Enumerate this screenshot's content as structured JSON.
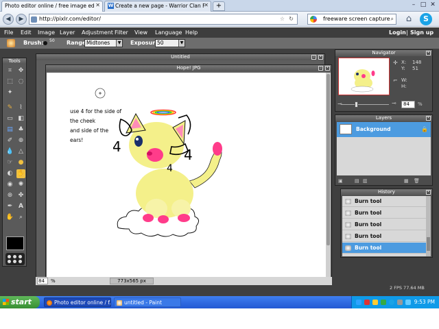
{
  "browser": {
    "tabs": [
      {
        "title": "Photo editor online / free image editing di...",
        "active": true
      },
      {
        "title": "Create a new page - Warrior Clan Fanfict...",
        "active": false
      }
    ],
    "url": "http://pixlr.com/editor/",
    "search_text": "freeware screen capture"
  },
  "menu": {
    "items": [
      "File",
      "Edit",
      "Image",
      "Layer",
      "Adjustment",
      "Filter",
      "View",
      "Language",
      "Help"
    ],
    "login": "Login",
    "signup": "Sign up",
    "separator": "|"
  },
  "tool_options": {
    "brush_label": "Brush:",
    "brush_size": "50",
    "range_label": "Range:",
    "range_value": "Midtones",
    "exposure_label": "Exposure:",
    "exposure_value": "50"
  },
  "tools_panel": {
    "title": "Tools"
  },
  "windows": {
    "untitled_title": "Untitled",
    "document_title": "Hope! JPG"
  },
  "canvas_note": {
    "lines": [
      "use 4 for the side of",
      "the cheek",
      "and side of the",
      "ears!"
    ],
    "marks": [
      "4",
      "4",
      "4"
    ]
  },
  "status": {
    "zoom": "84",
    "zoom_unit": "%",
    "size": "773x565 px"
  },
  "navigator": {
    "title": "Navigator",
    "x_label": "X:",
    "x_value": "148",
    "y_label": "Y:",
    "y_value": "51",
    "w_label": "W:",
    "h_label": "H:",
    "zoom": "84",
    "zoom_unit": "%"
  },
  "layers": {
    "title": "Layers",
    "items": [
      {
        "name": "Background",
        "active": true
      }
    ]
  },
  "history": {
    "title": "History",
    "items": [
      {
        "label": "Burn tool",
        "active": false
      },
      {
        "label": "Burn tool",
        "active": false
      },
      {
        "label": "Burn tool",
        "active": false
      },
      {
        "label": "Burn tool",
        "active": false
      },
      {
        "label": "Burn tool",
        "active": true
      }
    ]
  },
  "perf": "2 FPS 77.64 MB",
  "taskbar": {
    "start_label": "start",
    "tasks": [
      {
        "label": "Photo editor online / f...",
        "active": true
      },
      {
        "label": "untitled - Paint",
        "active": false
      }
    ],
    "clock": "9:53 PM"
  },
  "colors": {
    "menubar": "#3d3d3d",
    "selection": "#4c9be0",
    "taskbar": "#2259d3",
    "cat_yellow": "#f4f08a",
    "cat_pink": "#ff3c8a"
  }
}
